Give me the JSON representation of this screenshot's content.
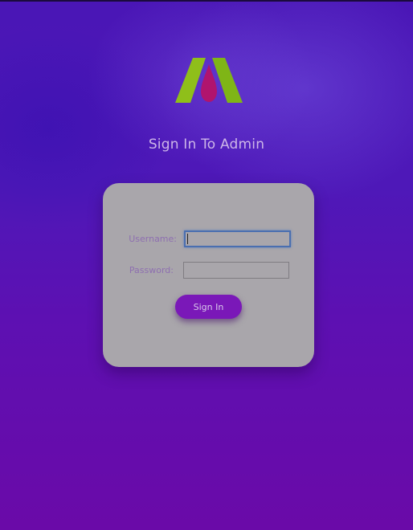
{
  "page": {
    "title": "Sign In To Admin"
  },
  "logo": {
    "icon": "brand-a-logo",
    "colors": {
      "left": "#8fbf1a",
      "right": "#7fb516",
      "center": "#b0146e"
    }
  },
  "form": {
    "username_label": "Username:",
    "username_value": "",
    "password_label": "Password:",
    "password_value": "",
    "submit_label": "Sign In"
  },
  "colors": {
    "accent": "#7a18b8",
    "card": "#a9a6ab",
    "label": "#8e6fb0",
    "title": "#cdb6e8"
  }
}
